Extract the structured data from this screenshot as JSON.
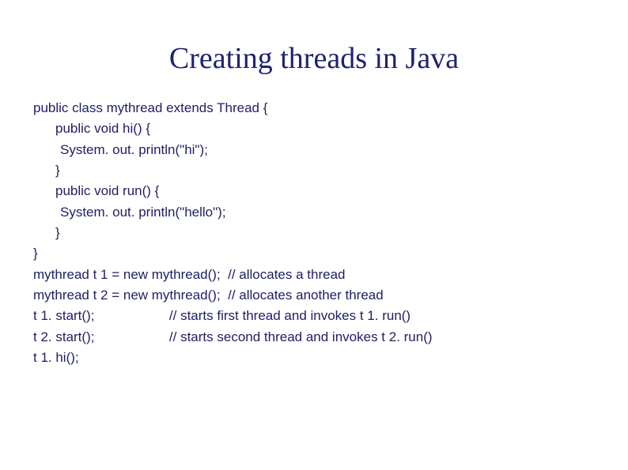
{
  "title": "Creating threads in Java",
  "code": {
    "line1": "public class mythread extends Thread {",
    "line2": "public void hi() {",
    "line3": "System. out. println(\"hi\");",
    "line4": "}",
    "line5": "public void run() {",
    "line6": "System. out. println(\"hello\");",
    "line7": "}",
    "line8": "}",
    "line9": "mythread t 1 = new mythread();  // allocates a thread",
    "line10": "mythread t 2 = new mythread();  // allocates another thread",
    "line11": "t 1. start();                    // starts first thread and invokes t 1. run()",
    "line12": "t 2. start();                    // starts second thread and invokes t 2. run()",
    "line13": "t 1. hi();"
  }
}
